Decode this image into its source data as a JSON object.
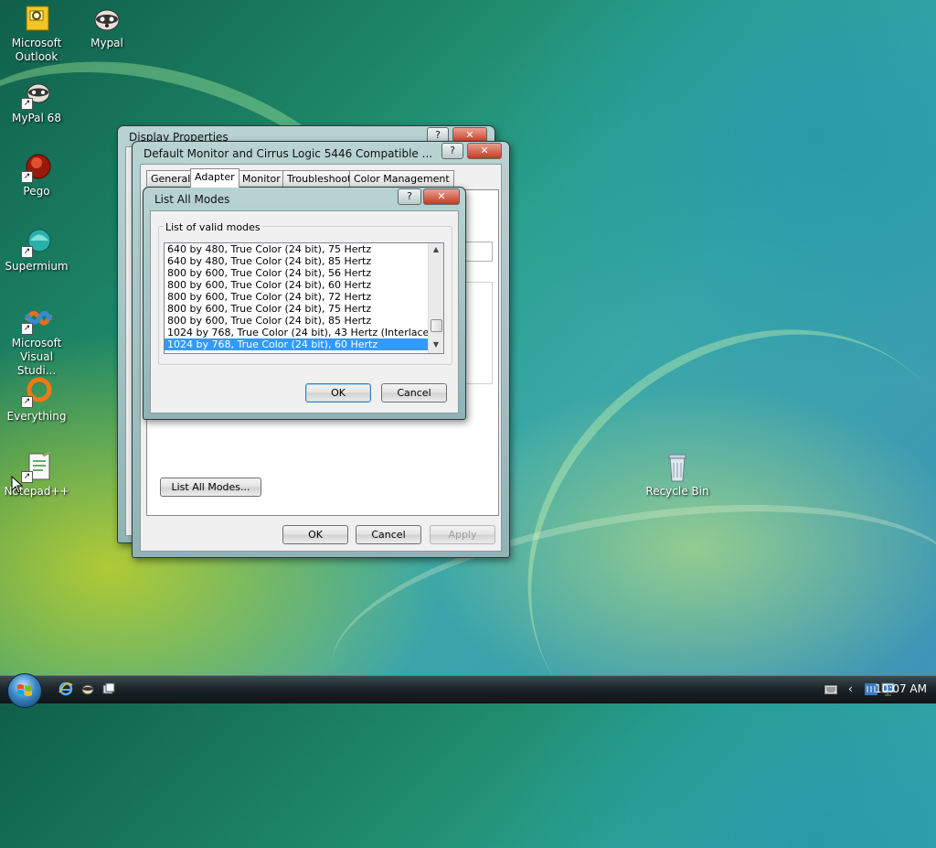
{
  "desktop": {
    "icons": [
      {
        "label": "Microsoft Outlook",
        "icon": "outlook-icon"
      },
      {
        "label": "Mypal",
        "icon": "mypal-icon"
      },
      {
        "label": "MyPal 68",
        "icon": "mypal68-icon"
      },
      {
        "label": "Pego",
        "icon": "pego-icon"
      },
      {
        "label": "Supermium",
        "icon": "supermium-icon"
      },
      {
        "label": "Microsoft Visual Studi...",
        "icon": "visual-studio-icon"
      },
      {
        "label": "Everything",
        "icon": "everything-icon"
      },
      {
        "label": "Notepad++",
        "icon": "notepad-plus-plus-icon"
      },
      {
        "label": "Recycle Bin",
        "icon": "recycle-bin-icon"
      }
    ]
  },
  "display_properties": {
    "title": "Display Properties",
    "help": "?",
    "close": "✕",
    "buttons": {
      "ok": "OK",
      "cancel": "Cancel",
      "apply": "Apply"
    }
  },
  "monitor_dialog": {
    "title": "Default Monitor and Cirrus Logic 5446 Compatible ...",
    "help": "?",
    "close": "✕",
    "tabs": [
      "General",
      "Adapter",
      "Monitor",
      "Troubleshoot",
      "Color Management"
    ],
    "active_tab": "Adapter",
    "list_all_modes_button": "List All Modes..."
  },
  "list_all_modes": {
    "title": "List All Modes",
    "help": "?",
    "close": "✕",
    "group_label": "List of valid modes",
    "modes": [
      "640 by 480, True Color (24 bit), 75 Hertz",
      "640 by 480, True Color (24 bit), 85 Hertz",
      "800 by 600, True Color (24 bit), 56 Hertz",
      "800 by 600, True Color (24 bit), 60 Hertz",
      "800 by 600, True Color (24 bit), 72 Hertz",
      "800 by 600, True Color (24 bit), 75 Hertz",
      "800 by 600, True Color (24 bit), 85 Hertz",
      "1024 by 768, True Color (24 bit), 43 Hertz (Interlaced)",
      "1024 by 768, True Color (24 bit), 60 Hertz"
    ],
    "selected_index": 8,
    "ok": "OK",
    "cancel": "Cancel"
  },
  "taskbar": {
    "start_icon": "windows-start-orb",
    "quick_launch": [
      "internet-explorer-icon",
      "mypal-icon",
      "switch-windows-icon"
    ],
    "tray_icons": [
      "keyboard-icon",
      "show-hidden-chevron-icon",
      "language-icon",
      "network-icon"
    ],
    "clock": "10:07 AM"
  }
}
